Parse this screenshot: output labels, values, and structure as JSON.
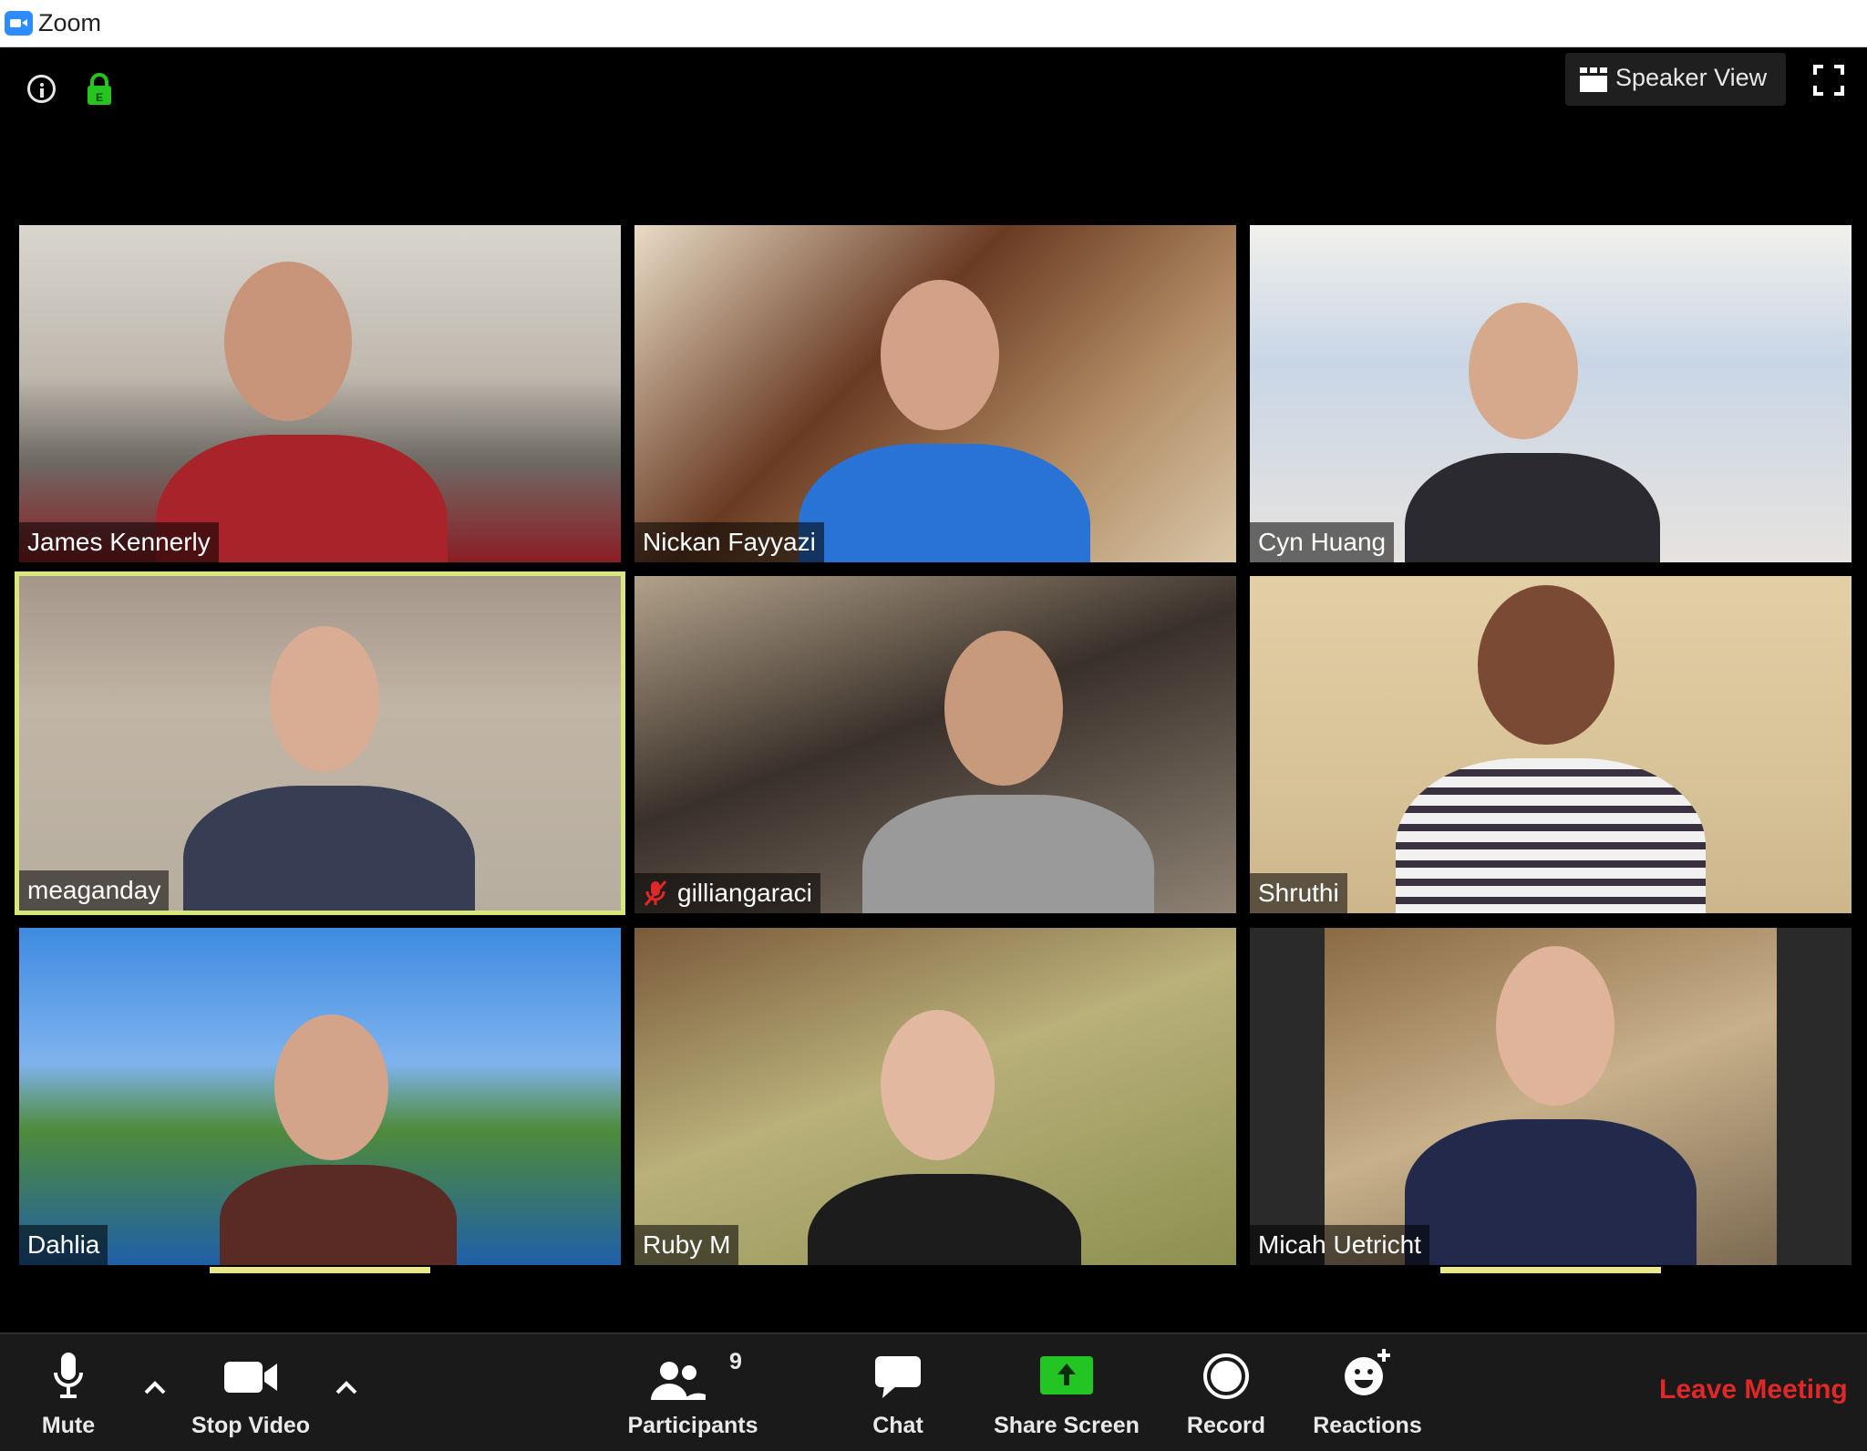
{
  "window": {
    "app_title": "Zoom"
  },
  "header": {
    "view_button_label": "Speaker View"
  },
  "participants_grid": [
    {
      "name": "James Kennerly",
      "muted": false
    },
    {
      "name": "Nickan Fayyazi",
      "muted": false
    },
    {
      "name": "Cyn Huang",
      "muted": false
    },
    {
      "name": "meaganday",
      "muted": false,
      "active_speaker": true
    },
    {
      "name": "gilliangaraci",
      "muted": true
    },
    {
      "name": "Shruthi",
      "muted": false
    },
    {
      "name": "Dahlia",
      "muted": false
    },
    {
      "name": "Ruby M",
      "muted": false
    },
    {
      "name": "Micah Uetricht",
      "muted": false
    }
  ],
  "toolbar": {
    "mute_label": "Mute",
    "stop_video_label": "Stop Video",
    "participants_label": "Participants",
    "participants_count": "9",
    "chat_label": "Chat",
    "share_screen_label": "Share Screen",
    "record_label": "Record",
    "reactions_label": "Reactions",
    "leave_label": "Leave Meeting"
  },
  "colors": {
    "active_speaker_border": "#d9e67a",
    "share_screen_green": "#23c523",
    "leave_red": "#e02828",
    "encryption_green": "#25c41f"
  },
  "icons": [
    "zoom-logo-icon",
    "info-icon",
    "lock-icon",
    "grid-icon",
    "fullscreen-icon",
    "microphone-icon",
    "chevron-up-icon",
    "video-camera-icon",
    "participants-icon",
    "chat-bubble-icon",
    "share-screen-icon",
    "record-icon",
    "reactions-icon",
    "muted-microphone-icon"
  ]
}
